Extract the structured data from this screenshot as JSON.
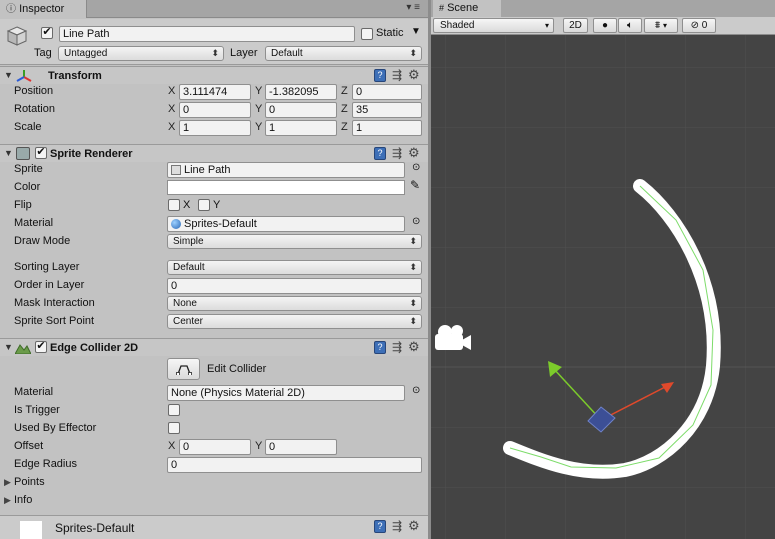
{
  "inspector": {
    "tab_label": "Inspector",
    "tab_icon": "info-icon",
    "menu_glyph": "▾ ≡",
    "object": {
      "name": "Line Path",
      "active": true,
      "static_label": "Static",
      "tag_label": "Tag",
      "tag_value": "Untagged",
      "layer_label": "Layer",
      "layer_value": "Default"
    },
    "transform": {
      "title": "Transform",
      "position_label": "Position",
      "rotation_label": "Rotation",
      "scale_label": "Scale",
      "position": {
        "x": "3.111474",
        "y": "-1.382095",
        "z": "0"
      },
      "rotation": {
        "x": "0",
        "y": "0",
        "z": "35"
      },
      "scale": {
        "x": "1",
        "y": "1",
        "z": "1"
      },
      "axis_x": "X",
      "axis_y": "Y",
      "axis_z": "Z"
    },
    "sprite_renderer": {
      "title": "Sprite Renderer",
      "enabled": true,
      "sprite_label": "Sprite",
      "sprite_value": "Line Path",
      "color_label": "Color",
      "color_value": "#ffffff",
      "flip_label": "Flip",
      "flip_x": "X",
      "flip_y": "Y",
      "material_label": "Material",
      "material_value": "Sprites-Default",
      "draw_mode_label": "Draw Mode",
      "draw_mode_value": "Simple",
      "sorting_layer_label": "Sorting Layer",
      "sorting_layer_value": "Default",
      "order_label": "Order in Layer",
      "order_value": "0",
      "mask_label": "Mask Interaction",
      "mask_value": "None",
      "sort_point_label": "Sprite Sort Point",
      "sort_point_value": "Center"
    },
    "edge_collider": {
      "title": "Edge Collider 2D",
      "enabled": true,
      "edit_label": "Edit Collider",
      "material_label": "Material",
      "material_value": "None (Physics Material 2D)",
      "is_trigger_label": "Is Trigger",
      "used_by_effector_label": "Used By Effector",
      "offset_label": "Offset",
      "offset": {
        "x": "0",
        "y": "0"
      },
      "edge_radius_label": "Edge Radius",
      "edge_radius_value": "0",
      "points_label": "Points",
      "info_label": "Info"
    },
    "footer_material": "Sprites-Default"
  },
  "scene": {
    "tab_label": "Scene",
    "shading_mode": "Shaded",
    "mode_2d": "2D",
    "gizmo_count": "0",
    "colors": {
      "background": "#444444",
      "grid": "#505050",
      "line": "#ffffff",
      "collider": "#7ddc6a",
      "x_axis": "#e0492b",
      "y_axis": "#7ccb2b"
    }
  }
}
